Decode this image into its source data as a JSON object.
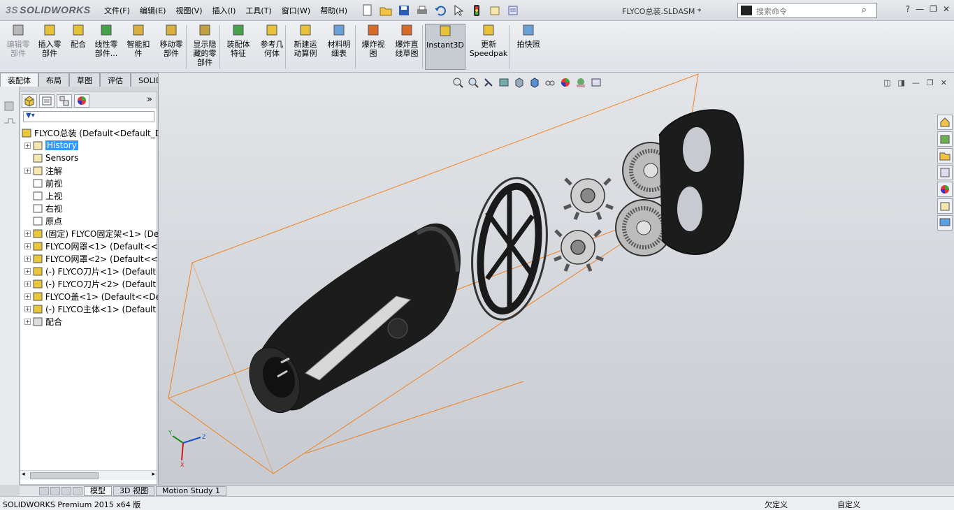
{
  "app": {
    "logo": "SOLIDWORKS",
    "doc_title": "FLYCO总装.SLDASM *"
  },
  "menu": [
    "文件(F)",
    "编辑(E)",
    "视图(V)",
    "插入(I)",
    "工具(T)",
    "窗口(W)",
    "帮助(H)"
  ],
  "search": {
    "placeholder": "搜索命令"
  },
  "commands": [
    {
      "label": "编辑零\n部件",
      "disabled": true
    },
    {
      "label": "插入零\n部件"
    },
    {
      "label": "配合"
    },
    {
      "label": "线性零\n部件..."
    },
    {
      "label": "智能扣\n件"
    },
    {
      "label": "移动零\n部件"
    },
    {
      "label": "显示隐\n藏的零\n部件"
    },
    {
      "label": "装配体\n特征"
    },
    {
      "label": "参考几\n何体"
    },
    {
      "label": "新建运\n动算例"
    },
    {
      "label": "材料明\n细表"
    },
    {
      "label": "爆炸视\n图"
    },
    {
      "label": "爆炸直\n线草图"
    },
    {
      "label": "Instant3D",
      "active": true
    },
    {
      "label": "更新\nSpeedpak"
    },
    {
      "label": "拍快照"
    }
  ],
  "tabs": [
    "装配体",
    "布局",
    "草图",
    "评估",
    "SOLIDWORKS 插件"
  ],
  "tree": {
    "root": "FLYCO总装  (Default<Default_D",
    "items": [
      {
        "label": "History",
        "highlight": true,
        "exp": true
      },
      {
        "label": "Sensors"
      },
      {
        "label": "注解",
        "exp": true
      },
      {
        "label": "前视"
      },
      {
        "label": "上视"
      },
      {
        "label": "右视"
      },
      {
        "label": "原点"
      },
      {
        "label": "(固定) FLYCO固定架<1> (De",
        "exp": true
      },
      {
        "label": "FLYCO网罩<1> (Default<<",
        "exp": true
      },
      {
        "label": "FLYCO网罩<2> (Default<<",
        "exp": true
      },
      {
        "label": "(-) FLYCO刀片<1> (Default",
        "exp": true
      },
      {
        "label": "(-) FLYCO刀片<2> (Default",
        "exp": true
      },
      {
        "label": "FLYCO盖<1> (Default<<De",
        "exp": true
      },
      {
        "label": "(-) FLYCO主体<1> (Default",
        "exp": true
      },
      {
        "label": "配合",
        "exp": true
      }
    ]
  },
  "bottom_tabs": [
    "模型",
    "3D 视图",
    "Motion Study 1"
  ],
  "status": {
    "left": "SOLIDWORKS Premium 2015 x64 版",
    "middle": "欠定义",
    "right": "自定义"
  },
  "triad": {
    "x": "X",
    "y": "Y",
    "z": "Z"
  },
  "colors": {
    "accent": "#3399ff",
    "bbox": "#f08020",
    "body": "#1c1c1c"
  }
}
